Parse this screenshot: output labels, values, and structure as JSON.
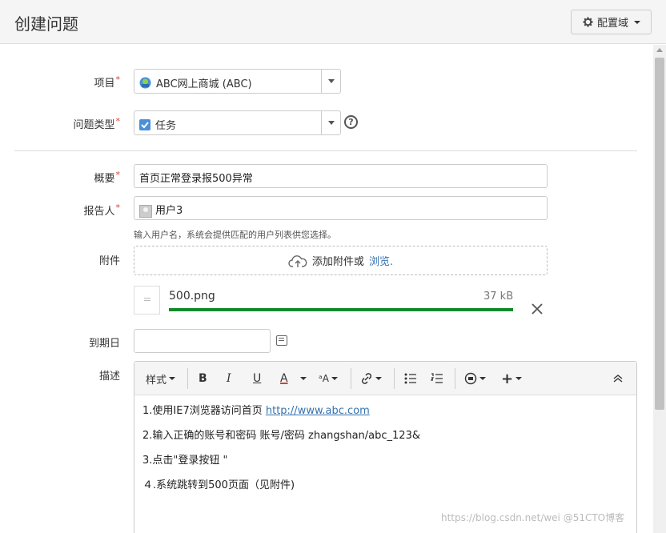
{
  "header": {
    "title": "创建问题",
    "config_label": "配置域"
  },
  "fields": {
    "project": {
      "label": "项目",
      "value": "ABC网上商城 (ABC)"
    },
    "issue_type": {
      "label": "问题类型",
      "value": "任务"
    },
    "summary": {
      "label": "概要",
      "value": "首页正常登录报500异常"
    },
    "reporter": {
      "label": "报告人",
      "value": "用户3",
      "hint": "输入用户名，系统会提供匹配的用户列表供您选择。"
    },
    "attachment": {
      "label": "附件",
      "drop_text": "添加附件或",
      "browse_link": "浏览.",
      "file": {
        "name": "500.png",
        "size": "37 kB",
        "progress_percent": 100
      }
    },
    "due_date": {
      "label": "到期日",
      "value": ""
    },
    "description": {
      "label": "描述",
      "toolbar": {
        "style": "样式"
      },
      "lines": [
        {
          "text": "1.使用IE7浏览器访问首页 ",
          "link": "http://www.abc.com"
        },
        {
          "text": "2.输入正确的账号和密码 账号/密码  zhangshan/abc_123&"
        },
        {
          "text": "3.点击\"登录按钮 \""
        },
        {
          "text": "４.系统跳转到500页面（见附件)"
        }
      ]
    }
  },
  "colors": {
    "required": "#d04437",
    "link": "#3572b0",
    "progress": "#14892c"
  },
  "watermark": "https://blog.csdn.net/wei @51CTO博客"
}
